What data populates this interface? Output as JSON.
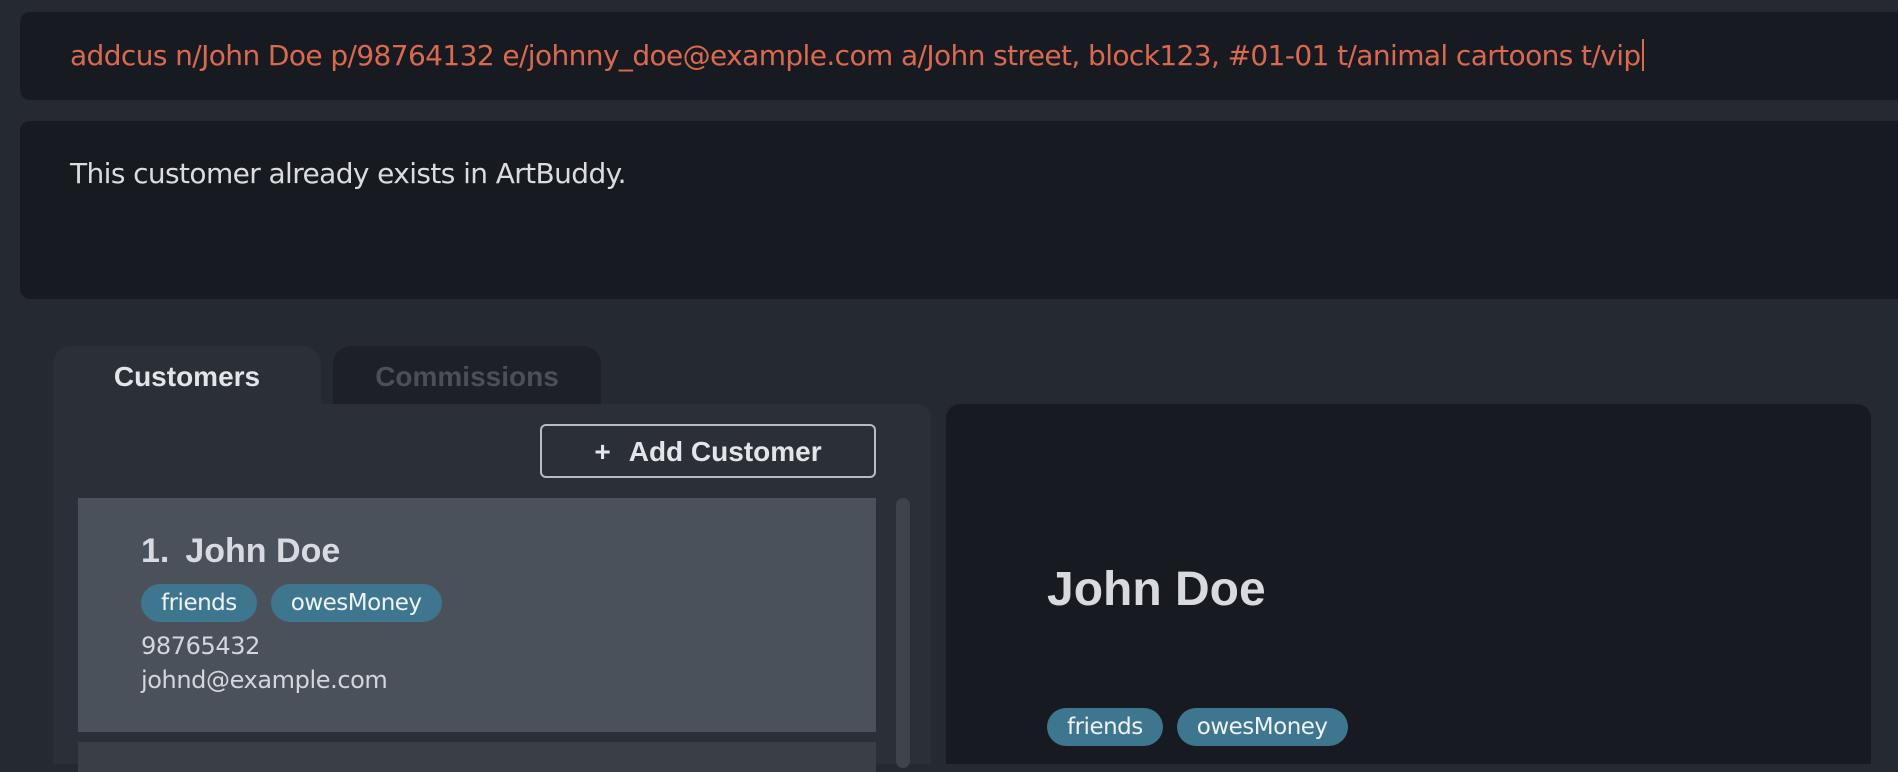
{
  "command": {
    "value": "addcus n/John Doe p/98764132 e/johnny_doe@example.com a/John street, block123, #01-01 t/animal cartoons t/vip"
  },
  "result": {
    "message": "This customer already exists in ArtBuddy."
  },
  "tabs": [
    {
      "label": "Customers",
      "active": true
    },
    {
      "label": "Commissions",
      "active": false
    }
  ],
  "toolbar": {
    "add_icon": "+",
    "add_label": "Add Customer"
  },
  "customers": [
    {
      "index": "1.",
      "name": "John Doe",
      "tags": [
        "friends",
        "owesMoney"
      ],
      "phone": "98765432",
      "email": "johnd@example.com"
    }
  ],
  "detail": {
    "name": "John Doe",
    "tags": [
      "friends",
      "owesMoney"
    ]
  },
  "colors": {
    "background": "#252932",
    "panel": "#181a21",
    "command_text": "#d9694f",
    "tag": "#3e7690",
    "selected_card": "#4b515b"
  }
}
